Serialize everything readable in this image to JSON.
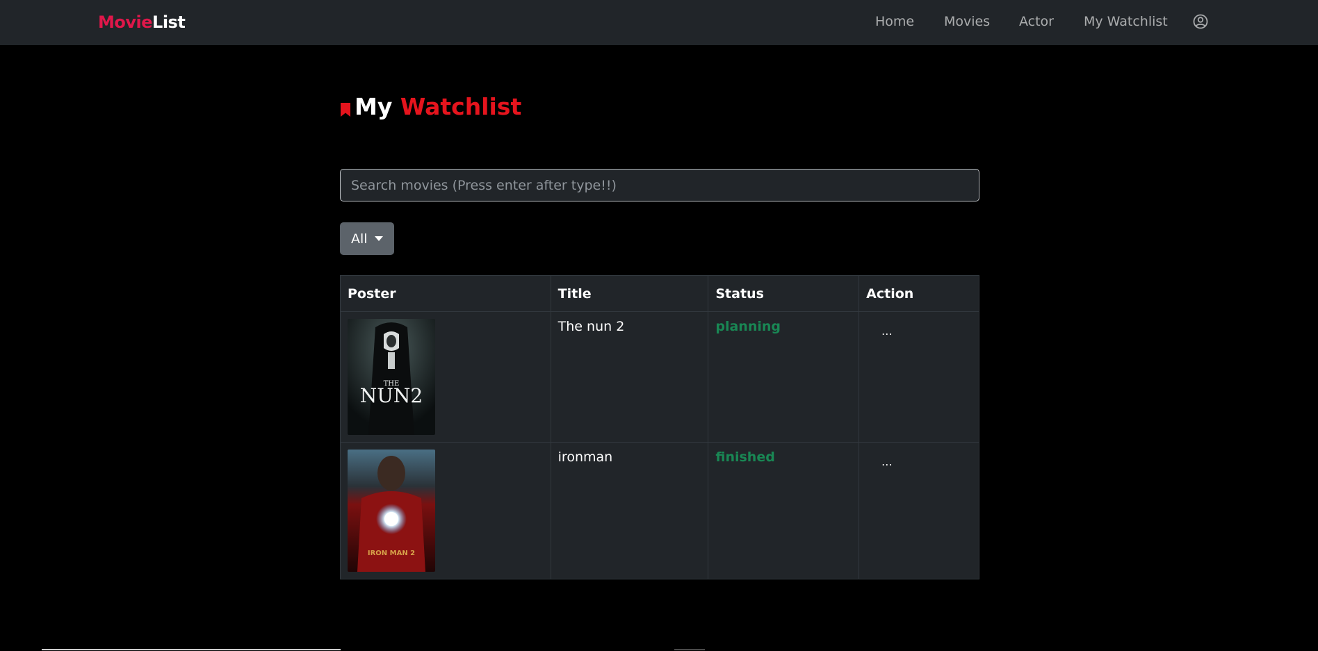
{
  "navbar": {
    "brand_part1": "Movie",
    "brand_part2": "List",
    "links": [
      "Home",
      "Movies",
      "Actor",
      "My Watchlist"
    ],
    "user_icon": "user-circle-icon"
  },
  "page": {
    "title_part1": "My",
    "title_part2": "Watchlist",
    "title_icon": "bookmark-icon"
  },
  "search": {
    "placeholder": "Search movies (Press enter after type!!)",
    "value": ""
  },
  "filter": {
    "selected": "All"
  },
  "table": {
    "headers": [
      "Poster",
      "Title",
      "Status",
      "Action"
    ],
    "rows": [
      {
        "poster_text_line1": "THE",
        "poster_text_line2": "NUN2",
        "title": "The nun 2",
        "status": "planning",
        "action": "..."
      },
      {
        "poster_text_line1": "IRON MAN 2",
        "poster_text_line2": "",
        "title": "ironman",
        "status": "finished",
        "action": "..."
      }
    ]
  },
  "colors": {
    "brand_red": "#e0174a",
    "heading_red": "#e5141d",
    "status_green": "#198754",
    "navbar_bg": "#212529"
  }
}
